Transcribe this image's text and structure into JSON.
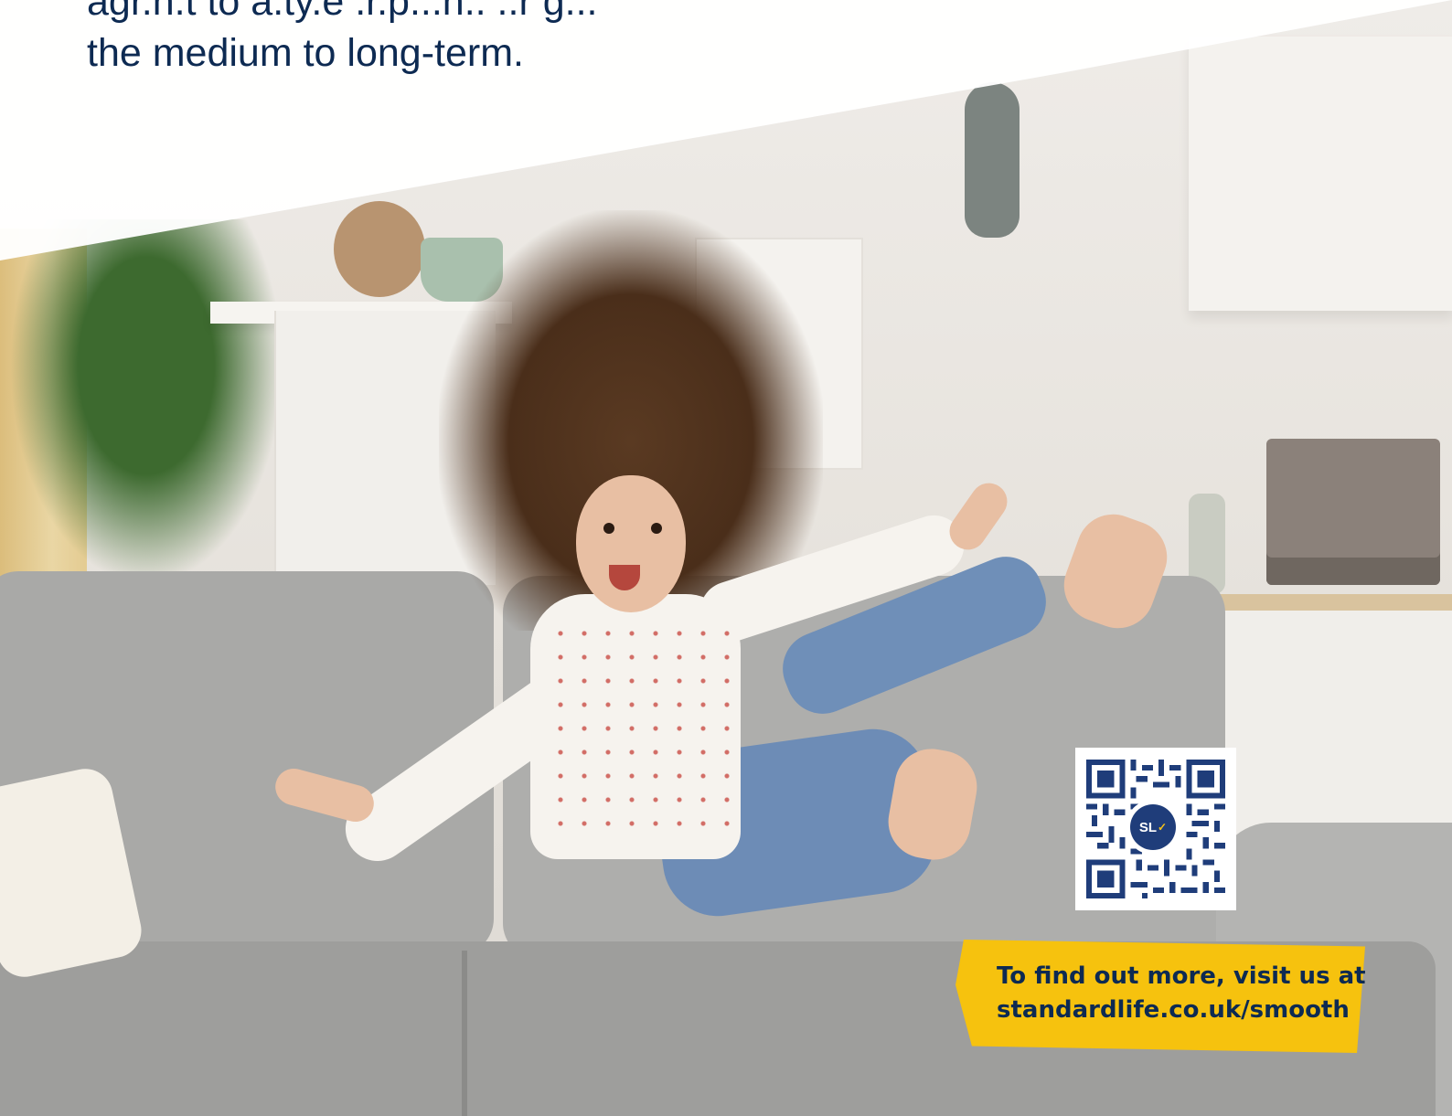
{
  "intro": {
    "line_partial": "agr.n.t to a.ty.e  .r.p...n.. ..r g...",
    "line_full": "the medium to long-term."
  },
  "qr": {
    "badge_text": "SL"
  },
  "cta": {
    "line1": "To find out more, visit us at",
    "line2": "standardlife.co.uk/smooth"
  },
  "colors": {
    "navy": "#0d2a52",
    "accent_yellow": "#f6c20e",
    "qr_blue": "#1f3d7a"
  }
}
